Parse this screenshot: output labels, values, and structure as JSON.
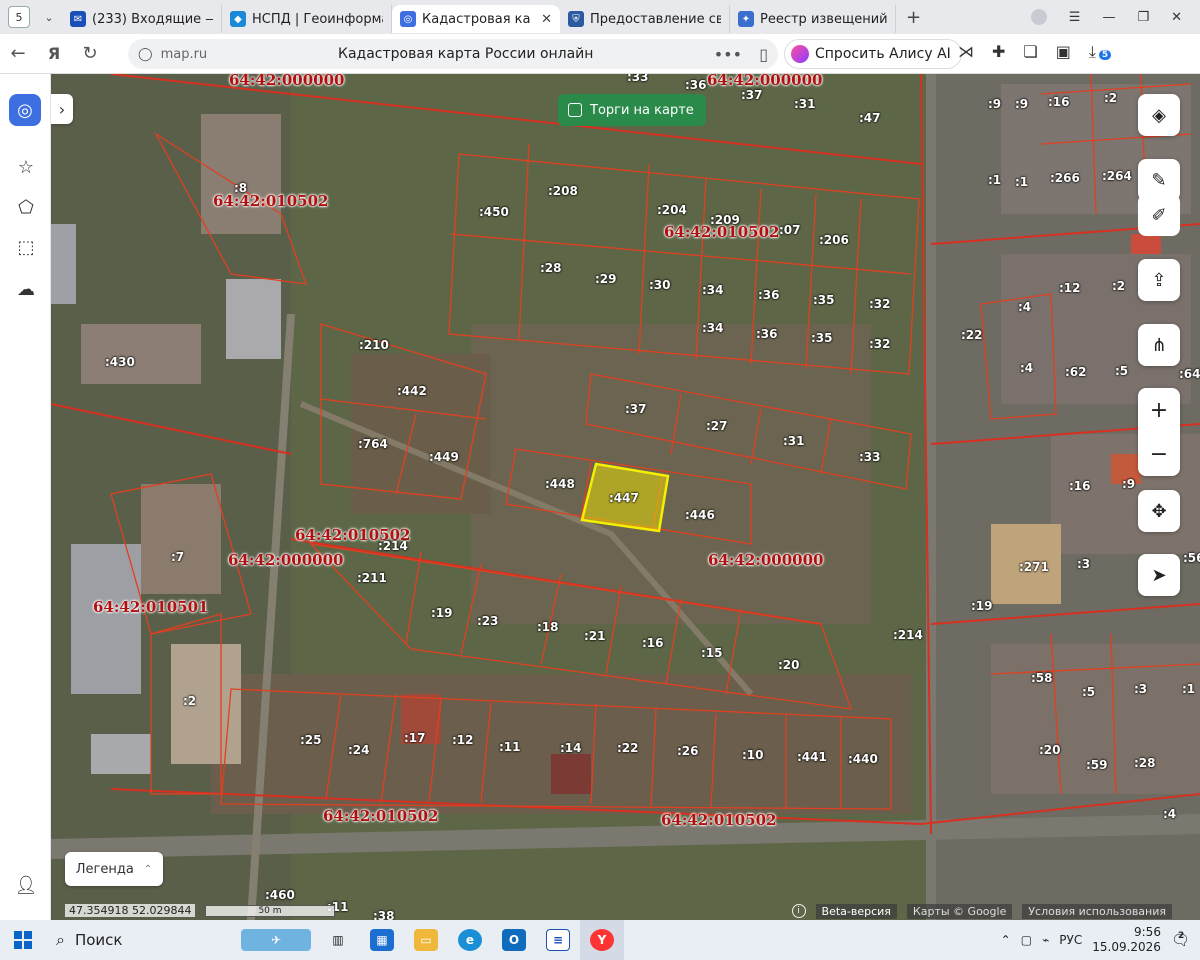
{
  "browser": {
    "tab_count": "5",
    "tabs": [
      {
        "title": "(233) Входящие — Рам",
        "icon": "mail-icon",
        "color": "#1a4fb8"
      },
      {
        "title": "НСПД | Геоинформаци",
        "icon": "nspd-icon",
        "color": "#1a8ad8"
      },
      {
        "title": "Кадастровая карта",
        "icon": "kadastr-icon",
        "color": "#3d6fe0",
        "active": true
      },
      {
        "title": "Предоставление свед",
        "icon": "shield-icon",
        "color": "#2c5aa0"
      },
      {
        "title": "Реестр извещений",
        "icon": "emblem-icon",
        "color": "#3a6fd0"
      }
    ],
    "address_host": "map.ru",
    "page_title": "Кадастровая карта России онлайн",
    "alice_label": "Спросить Алису AI",
    "downloads_badge": "5"
  },
  "map": {
    "torgi_label": "Торги на карте",
    "legend_label": "Легенда",
    "coordinates": "47.354918  52.029844",
    "scale_label": "50 m",
    "beta_label": "Beta-версия",
    "copyright": "Карты © Google",
    "terms": "Условия использования",
    "selected_parcel": ":447",
    "selected_color": "#f2e600",
    "boundary_color": "#e04020",
    "quarter_labels": [
      "64:42:000000",
      "64:42:000000",
      "64:42:010502",
      "64:42:010502",
      "64:42:010502",
      "64:42:000000",
      "64:42:000000",
      "64:42:010501",
      "64:42:010502",
      "64:42:010502"
    ],
    "parcel_labels": [
      ":33",
      ":36",
      ":37",
      ":31",
      ":47",
      ":9",
      ":9",
      ":16",
      ":2",
      ":8",
      ":450",
      ":208",
      ":204",
      ":209",
      ":07",
      ":206",
      ":1",
      ":1",
      ":266",
      ":264",
      ":28",
      ":29",
      ":30",
      ":34",
      ":36",
      ":35",
      ":32",
      ":34",
      ":36",
      ":35",
      ":32",
      ":430",
      ":210",
      ":442",
      ":22",
      ":4",
      ":12",
      ":2",
      ":4",
      ":62",
      ":5",
      ":64",
      ":37",
      ":27",
      ":31",
      ":764",
      ":449",
      ":33",
      ":448",
      ":447",
      ":446",
      ":16",
      ":9",
      ":214",
      ":211",
      ":7",
      ":271",
      ":3",
      ":56",
      ":19",
      ":23",
      ":18",
      ":21",
      ":16",
      ":15",
      ":20",
      ":214",
      ":19",
      ":58",
      ":5",
      ":3",
      ":1",
      ":2",
      ":25",
      ":24",
      ":17",
      ":12",
      ":11",
      ":14",
      ":22",
      ":26",
      ":10",
      ":441",
      ":440",
      ":20",
      ":59",
      ":28",
      ":460",
      ":11",
      ":38",
      ":4"
    ]
  },
  "taskbar": {
    "search_label": "Поиск",
    "language": "РУС",
    "time": "9:56",
    "date": "15.09.2026",
    "notifications": "2"
  }
}
